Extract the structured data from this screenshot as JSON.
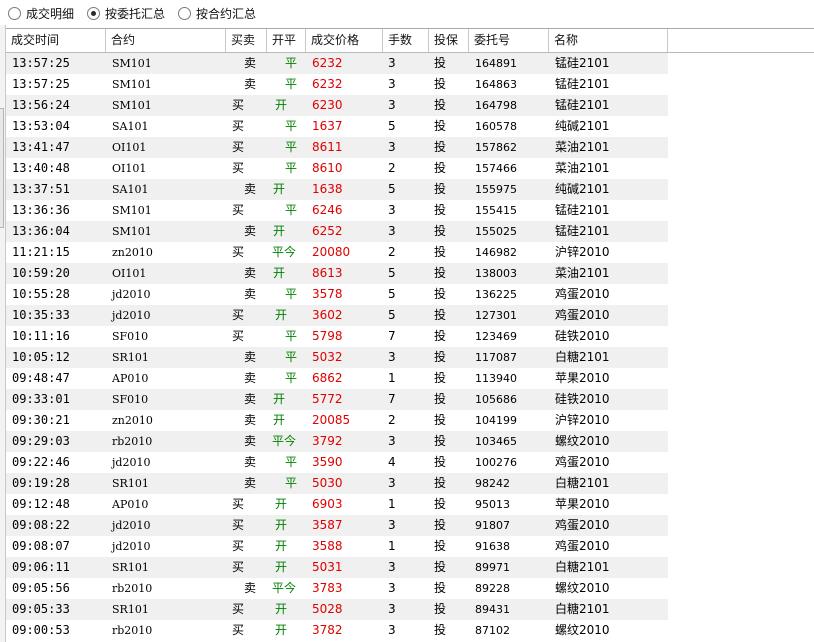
{
  "tabs": [
    {
      "label": "成交明细",
      "checked": false
    },
    {
      "label": "按委托汇总",
      "checked": true
    },
    {
      "label": "按合约汇总",
      "checked": false
    }
  ],
  "columns": [
    "成交时间",
    "合约",
    "买卖",
    "开平",
    "成交价格",
    "手数",
    "投保",
    "委托号",
    "名称"
  ],
  "colors": {
    "price": "#e00000",
    "open_close": "#008000",
    "alt_row": "#f0f0f0"
  },
  "rows": [
    {
      "time": "13:57:25",
      "contract": "SM101",
      "dir": "卖",
      "oc": "平",
      "price": "6232",
      "qty": "3",
      "hedge": "投",
      "order": "164891",
      "name": "锰硅2101"
    },
    {
      "time": "13:57:25",
      "contract": "SM101",
      "dir": "卖",
      "oc": "平",
      "price": "6232",
      "qty": "3",
      "hedge": "投",
      "order": "164863",
      "name": "锰硅2101"
    },
    {
      "time": "13:56:24",
      "contract": "SM101",
      "dir": "买",
      "oc": "开",
      "price": "6230",
      "qty": "3",
      "hedge": "投",
      "order": "164798",
      "name": "锰硅2101"
    },
    {
      "time": "13:53:04",
      "contract": "SA101",
      "dir": "买",
      "oc": "平",
      "price": "1637",
      "qty": "5",
      "hedge": "投",
      "order": "160578",
      "name": "纯碱2101"
    },
    {
      "time": "13:41:47",
      "contract": "OI101",
      "dir": "买",
      "oc": "平",
      "price": "8611",
      "qty": "3",
      "hedge": "投",
      "order": "157862",
      "name": "菜油2101"
    },
    {
      "time": "13:40:48",
      "contract": "OI101",
      "dir": "买",
      "oc": "平",
      "price": "8610",
      "qty": "2",
      "hedge": "投",
      "order": "157466",
      "name": "菜油2101"
    },
    {
      "time": "13:37:51",
      "contract": "SA101",
      "dir": "卖",
      "oc": "开",
      "price": "1638",
      "qty": "5",
      "hedge": "投",
      "order": "155975",
      "name": "纯碱2101"
    },
    {
      "time": "13:36:36",
      "contract": "SM101",
      "dir": "买",
      "oc": "平",
      "price": "6246",
      "qty": "3",
      "hedge": "投",
      "order": "155415",
      "name": "锰硅2101"
    },
    {
      "time": "13:36:04",
      "contract": "SM101",
      "dir": "卖",
      "oc": "开",
      "price": "6252",
      "qty": "3",
      "hedge": "投",
      "order": "155025",
      "name": "锰硅2101"
    },
    {
      "time": "11:21:15",
      "contract": "zn2010",
      "dir": "买",
      "oc": "平今",
      "price": "20080",
      "qty": "2",
      "hedge": "投",
      "order": "146982",
      "name": "沪锌2010"
    },
    {
      "time": "10:59:20",
      "contract": "OI101",
      "dir": "卖",
      "oc": "开",
      "price": "8613",
      "qty": "5",
      "hedge": "投",
      "order": "138003",
      "name": "菜油2101"
    },
    {
      "time": "10:55:28",
      "contract": "jd2010",
      "dir": "卖",
      "oc": "平",
      "price": "3578",
      "qty": "5",
      "hedge": "投",
      "order": "136225",
      "name": "鸡蛋2010"
    },
    {
      "time": "10:35:33",
      "contract": "jd2010",
      "dir": "买",
      "oc": "开",
      "price": "3602",
      "qty": "5",
      "hedge": "投",
      "order": "127301",
      "name": "鸡蛋2010"
    },
    {
      "time": "10:11:16",
      "contract": "SF010",
      "dir": "买",
      "oc": "平",
      "price": "5798",
      "qty": "7",
      "hedge": "投",
      "order": "123469",
      "name": "硅铁2010"
    },
    {
      "time": "10:05:12",
      "contract": "SR101",
      "dir": "卖",
      "oc": "平",
      "price": "5032",
      "qty": "3",
      "hedge": "投",
      "order": "117087",
      "name": "白糖2101"
    },
    {
      "time": "09:48:47",
      "contract": "AP010",
      "dir": "卖",
      "oc": "平",
      "price": "6862",
      "qty": "1",
      "hedge": "投",
      "order": "113940",
      "name": "苹果2010"
    },
    {
      "time": "09:33:01",
      "contract": "SF010",
      "dir": "卖",
      "oc": "开",
      "price": "5772",
      "qty": "7",
      "hedge": "投",
      "order": "105686",
      "name": "硅铁2010"
    },
    {
      "time": "09:30:21",
      "contract": "zn2010",
      "dir": "卖",
      "oc": "开",
      "price": "20085",
      "qty": "2",
      "hedge": "投",
      "order": "104199",
      "name": "沪锌2010"
    },
    {
      "time": "09:29:03",
      "contract": "rb2010",
      "dir": "卖",
      "oc": "平今",
      "price": "3792",
      "qty": "3",
      "hedge": "投",
      "order": "103465",
      "name": "螺纹2010"
    },
    {
      "time": "09:22:46",
      "contract": "jd2010",
      "dir": "卖",
      "oc": "平",
      "price": "3590",
      "qty": "4",
      "hedge": "投",
      "order": "100276",
      "name": "鸡蛋2010"
    },
    {
      "time": "09:19:28",
      "contract": "SR101",
      "dir": "卖",
      "oc": "平",
      "price": "5030",
      "qty": "3",
      "hedge": "投",
      "order": "98242",
      "name": "白糖2101"
    },
    {
      "time": "09:12:48",
      "contract": "AP010",
      "dir": "买",
      "oc": "开",
      "price": "6903",
      "qty": "1",
      "hedge": "投",
      "order": "95013",
      "name": "苹果2010"
    },
    {
      "time": "09:08:22",
      "contract": "jd2010",
      "dir": "买",
      "oc": "开",
      "price": "3587",
      "qty": "3",
      "hedge": "投",
      "order": "91807",
      "name": "鸡蛋2010"
    },
    {
      "time": "09:08:07",
      "contract": "jd2010",
      "dir": "买",
      "oc": "开",
      "price": "3588",
      "qty": "1",
      "hedge": "投",
      "order": "91638",
      "name": "鸡蛋2010"
    },
    {
      "time": "09:06:11",
      "contract": "SR101",
      "dir": "买",
      "oc": "开",
      "price": "5031",
      "qty": "3",
      "hedge": "投",
      "order": "89971",
      "name": "白糖2101"
    },
    {
      "time": "09:05:56",
      "contract": "rb2010",
      "dir": "卖",
      "oc": "平今",
      "price": "3783",
      "qty": "3",
      "hedge": "投",
      "order": "89228",
      "name": "螺纹2010"
    },
    {
      "time": "09:05:33",
      "contract": "SR101",
      "dir": "买",
      "oc": "开",
      "price": "5028",
      "qty": "3",
      "hedge": "投",
      "order": "89431",
      "name": "白糖2101"
    },
    {
      "time": "09:00:53",
      "contract": "rb2010",
      "dir": "买",
      "oc": "开",
      "price": "3782",
      "qty": "3",
      "hedge": "投",
      "order": "87102",
      "name": "螺纹2010"
    }
  ]
}
